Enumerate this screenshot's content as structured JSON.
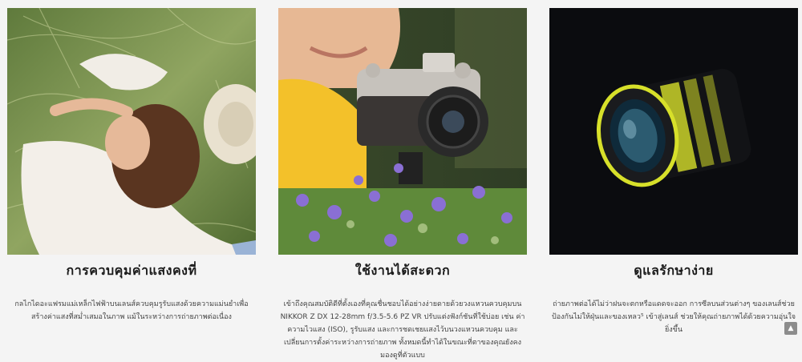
{
  "features": [
    {
      "title": "การควบคุมค่าแสงคงที่",
      "description": "กลไกไดอะแฟรมแม่เหล็กไฟฟ้าบนเลนส์ควบคุมรูรับแสงด้วยความแม่นยำเพื่อสร้างค่าแสงที่สม่ำเสมอในภาพ แม้ในระหว่างการถ่ายภาพต่อเนื่อง",
      "image_icon": "woman-lying-in-grass-photo"
    },
    {
      "title": "ใช้งานได้สะดวก",
      "description": "เข้าถึงคุณสมบัติดีที่ตั้งเองที่คุณชื่นชอบได้อย่างง่ายดายด้วยวงแหวนควบคุมบน NIKKOR Z DX 12-28mm f/3.5-5.6 PZ VR ปรับแต่งฟังก์ชันที่ใช้บ่อย เช่น ค่าความไวแสง (ISO), รูรับแสง และการชดเชยแสงไว้บนวงแหวนควบคุม และเปลี่ยนการตั้งค่าระหว่างการถ่ายภาพ ทั้งหมดนี้ทำได้ในขณะที่ตาของคุณยังคงมองดูที่ตัวแบบ",
      "image_icon": "nikon-camera-flowers-photo"
    },
    {
      "title": "ดูแลรักษาง่าย",
      "description": "ถ่ายภาพต่อได้ไม่ว่าฝนจะตกหรือแดดจะออก การซีลบนส่วนต่างๆ ของเลนส์ช่วยป้องกันไม่ให้ฝุ่นและของเหลว⁵ เข้าสู่เลนส์ ช่วยให้คุณถ่ายภาพได้ด้วยความอุ่นใจยิ่งขึ้น",
      "image_icon": "nikkor-lens-sealing-photo"
    }
  ],
  "scroll_top": {
    "icon": "arrow-up-icon",
    "glyph": "▲"
  },
  "colors": {
    "background": "#f4f4f4",
    "lens_seal": "#d7e02a",
    "scroll_button": "#8c8c8c"
  }
}
